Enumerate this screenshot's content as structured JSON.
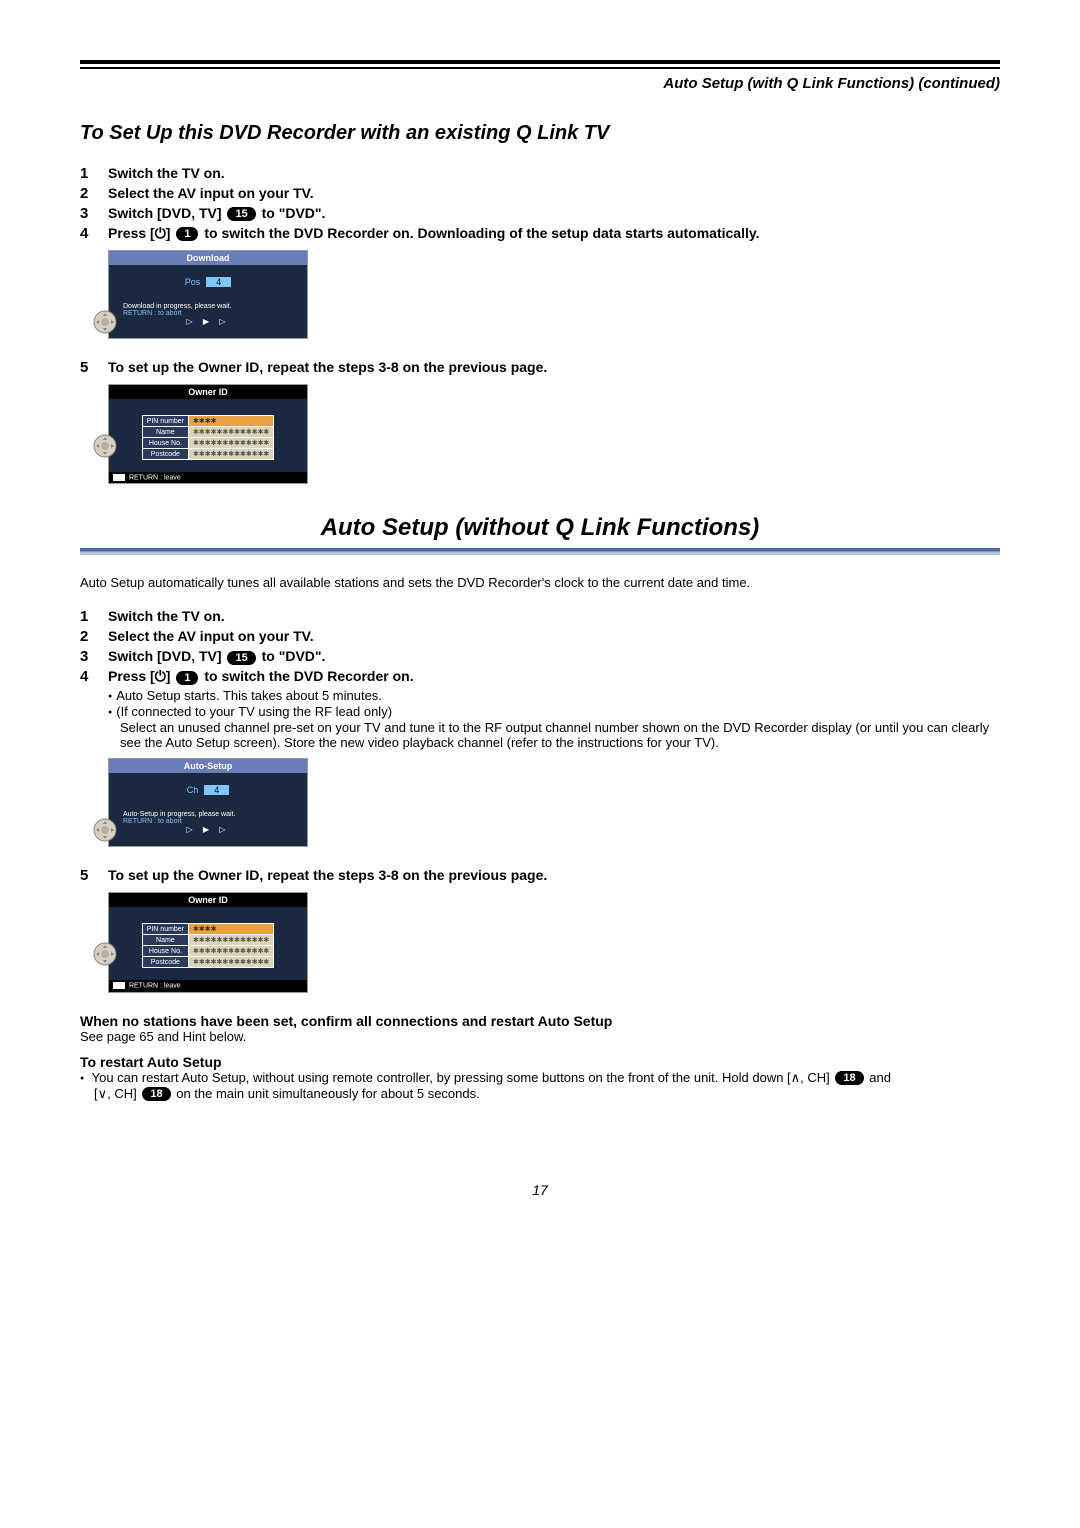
{
  "header": {
    "title_right": "Auto Setup (with Q Link Functions) (continued)"
  },
  "section1": {
    "title": "To Set Up this DVD Recorder with an existing Q Link TV",
    "steps": [
      {
        "num": "1",
        "text": "Switch the TV on."
      },
      {
        "num": "2",
        "text": "Select the AV input on your TV."
      },
      {
        "num": "3",
        "text_pre": "Switch [DVD, TV] ",
        "badge": "15",
        "text_post": " to \"DVD\"."
      },
      {
        "num": "4",
        "text_pre": "Press [⏻] ",
        "badge": "1",
        "text_post": " to switch the DVD Recorder on. Downloading of the setup data starts automatically."
      },
      {
        "num": "5",
        "text": "To set up the Owner ID, repeat the steps 3-8 on the previous page."
      }
    ]
  },
  "screen_download": {
    "title": "Download",
    "pos_label": "Pos",
    "pos_value": "4",
    "msg1": "Download in progress, please wait.",
    "msg2": "RETURN : to abort",
    "arrows": "▷ ▶ ▷"
  },
  "screen_owner": {
    "title": "Owner ID",
    "rows": [
      {
        "label": "PIN number",
        "value": "✱✱✱✱",
        "active": true
      },
      {
        "label": "Name",
        "value": "✱✱✱✱✱✱✱✱✱✱✱✱✱"
      },
      {
        "label": "House No.",
        "value": "✱✱✱✱✱✱✱✱✱✱✱✱✱"
      },
      {
        "label": "Postcode",
        "value": "✱✱✱✱✱✱✱✱✱✱✱✱✱"
      }
    ],
    "return_text": " RETURN : leave"
  },
  "main_title": "Auto Setup (without Q Link Functions)",
  "intro": "Auto Setup automatically tunes all available stations and sets the DVD Recorder's clock to the current date and time.",
  "section2": {
    "steps": [
      {
        "num": "1",
        "text": "Switch the TV on."
      },
      {
        "num": "2",
        "text": "Select the AV input on your TV."
      },
      {
        "num": "3",
        "text_pre": "Switch [DVD, TV] ",
        "badge": "15",
        "text_post": " to \"DVD\"."
      },
      {
        "num": "4",
        "text_pre": "Press [⏻] ",
        "badge": "1",
        "text_post": " to switch the DVD Recorder on."
      }
    ],
    "bullets": [
      "Auto Setup starts. This takes about 5 minutes.",
      "(If connected to your TV using the RF lead only)"
    ],
    "detail": "Select an unused channel pre-set on your TV and tune it to the RF output channel number shown on the DVD Recorder display (or until you can clearly see the Auto Setup screen). Store the new video playback channel (refer to the instructions for your TV).",
    "step5": {
      "num": "5",
      "text": "To set up the Owner ID, repeat the steps 3-8 on the previous page."
    }
  },
  "screen_autosetup": {
    "title": "Auto-Setup",
    "ch_label": "Ch",
    "ch_value": "4",
    "msg1": "Auto-Setup in progress, please wait.",
    "msg2": "RETURN : to abort",
    "arrows": "▷ ▶ ▷"
  },
  "notes": {
    "h1": "When no stations have been set, confirm all connections and restart Auto Setup",
    "t1": "See page 65 and Hint below.",
    "h2": "To restart Auto Setup",
    "b1_pre": "You can restart Auto Setup, without using remote controller, by pressing some buttons on the front of the unit. Hold down [∧, CH] ",
    "b1_badge": "18",
    "b1_post": " and",
    "b2_pre": "[∨, CH] ",
    "b2_badge": "18",
    "b2_post": " on the main unit simultaneously for about 5 seconds."
  },
  "page": "17"
}
